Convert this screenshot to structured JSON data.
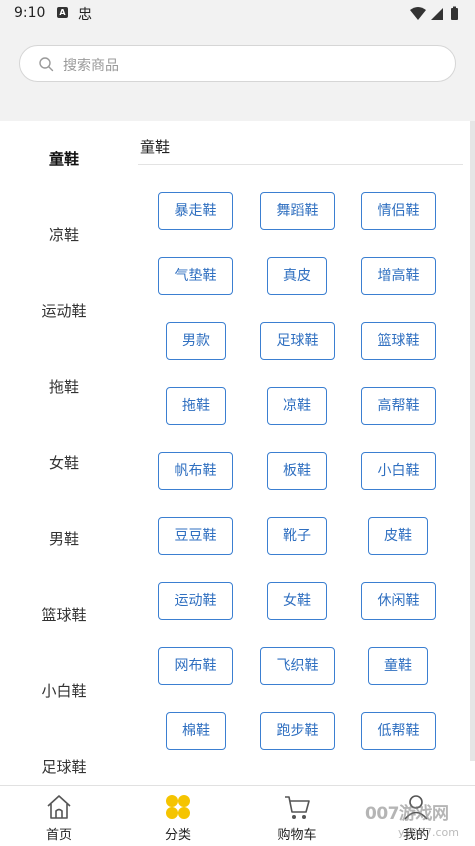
{
  "status_bar": {
    "time": "9:10",
    "badge": "A",
    "app_glyph": "忠"
  },
  "search": {
    "placeholder": "搜索商品"
  },
  "sidebar": {
    "items": [
      {
        "label": "童鞋",
        "active": true
      },
      {
        "label": "凉鞋"
      },
      {
        "label": "运动鞋"
      },
      {
        "label": "拖鞋"
      },
      {
        "label": "女鞋"
      },
      {
        "label": "男鞋"
      },
      {
        "label": "篮球鞋"
      },
      {
        "label": "小白鞋"
      },
      {
        "label": "足球鞋"
      }
    ]
  },
  "content": {
    "title": "童鞋",
    "tags": [
      "暴走鞋",
      "舞蹈鞋",
      "情侣鞋",
      "气垫鞋",
      "真皮",
      "增高鞋",
      "男款",
      "足球鞋",
      "篮球鞋",
      "拖鞋",
      "凉鞋",
      "高帮鞋",
      "帆布鞋",
      "板鞋",
      "小白鞋",
      "豆豆鞋",
      "靴子",
      "皮鞋",
      "运动鞋",
      "女鞋",
      "休闲鞋",
      "网布鞋",
      "飞织鞋",
      "童鞋",
      "棉鞋",
      "跑步鞋",
      "低帮鞋"
    ]
  },
  "bottom_nav": {
    "items": [
      {
        "label": "首页",
        "icon": "home-icon"
      },
      {
        "label": "分类",
        "icon": "category-icon",
        "active": true
      },
      {
        "label": "购物车",
        "icon": "cart-icon"
      },
      {
        "label": "我的",
        "icon": "user-icon"
      }
    ]
  },
  "watermark": {
    "text": "007游戏网",
    "sub": "yx007.com"
  },
  "colors": {
    "accent": "#f5c400",
    "tag_border": "#3b7fd1",
    "tag_text": "#2f6fc0",
    "header_bg": "#f2f2f2"
  }
}
